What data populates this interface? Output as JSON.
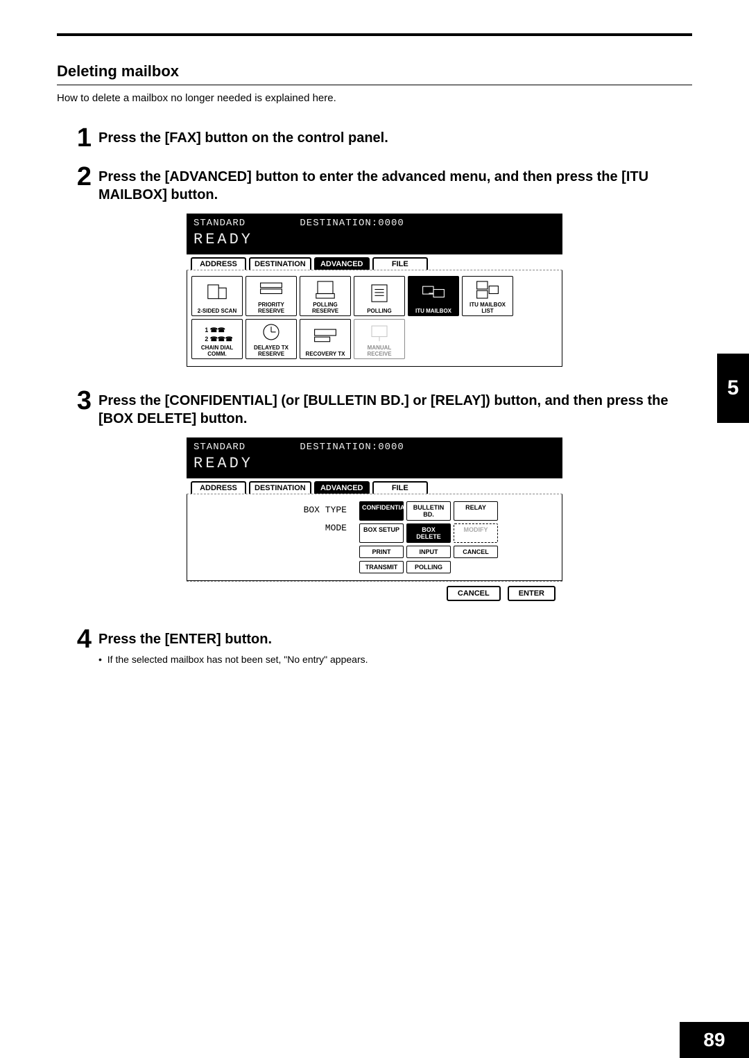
{
  "chapter_number": "5",
  "page_number": "89",
  "section": {
    "title": "Deleting mailbox",
    "intro": "How to delete a mailbox no longer needed is explained here."
  },
  "steps": [
    {
      "num": "1",
      "text": "Press the [FAX] button on the control panel."
    },
    {
      "num": "2",
      "text": "Press the [ADVANCED] button to enter the advanced menu, and then press the [ITU MAILBOX] button."
    },
    {
      "num": "3",
      "text": "Press the [CONFIDENTIAL] (or [BULLETIN BD.] or [RELAY]) button, and then press the [BOX DELETE] button."
    },
    {
      "num": "4",
      "text": "Press the [ENTER] button.",
      "sub": "If the selected mailbox has not been set, \"No entry\" appears."
    }
  ],
  "screen_common": {
    "header_left": "STANDARD",
    "header_right": "DESTINATION:0000",
    "ready": "READY",
    "tabs": {
      "address": "ADDRESS",
      "destination": "DESTINATION",
      "advanced": "ADVANCED",
      "file": "FILE"
    }
  },
  "screen1": {
    "buttons": {
      "two_sided": "2-SIDED SCAN",
      "priority": "PRIORITY RESERVE",
      "polling_res": "POLLING RESERVE",
      "polling": "POLLING",
      "itu_mailbox": "ITU MAILBOX",
      "itu_list": "ITU MAILBOX LIST",
      "chain_dial": "CHAIN DIAL COMM.",
      "delayed_tx": "DELAYED TX RESERVE",
      "recovery_tx": "RECOVERY TX",
      "manual_rec": "MANUAL RECEIVE"
    }
  },
  "screen2": {
    "labels": {
      "box_type": "BOX TYPE",
      "mode": "MODE"
    },
    "buttons": {
      "confidential": "CONFIDENTIAL",
      "bulletin": "BULLETIN BD.",
      "relay": "RELAY",
      "box_setup": "BOX SETUP",
      "box_delete": "BOX DELETE",
      "modify": "MODIFY",
      "print": "PRINT",
      "input": "INPUT",
      "cancel_s": "CANCEL",
      "transmit": "TRANSMIT",
      "polling_s": "POLLING"
    },
    "bottom": {
      "cancel": "CANCEL",
      "enter": "ENTER"
    }
  }
}
